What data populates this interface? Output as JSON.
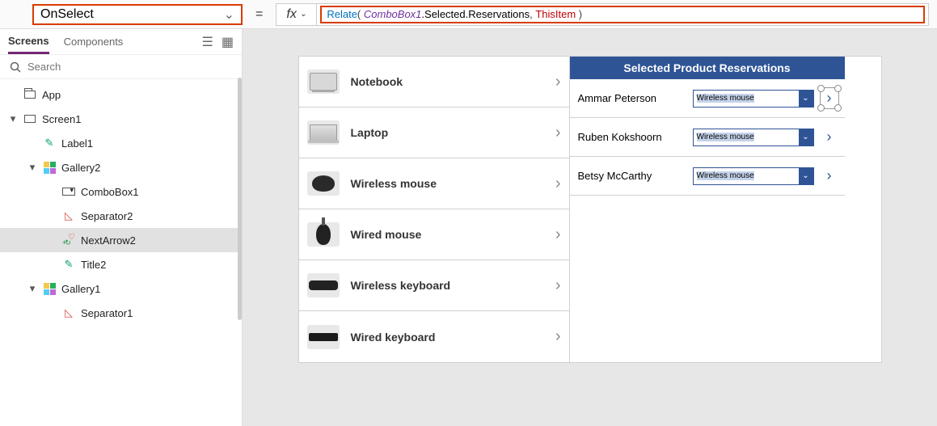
{
  "property_selector": {
    "value": "OnSelect"
  },
  "formula_bar": {
    "fx_label": "fx",
    "tokens": {
      "fn": "Relate",
      "p1": "( ",
      "var": "ComboBox1",
      "prop": ".Selected.Reservations",
      "c": ", ",
      "this": "ThisItem",
      "p2": " )"
    }
  },
  "sidebar": {
    "tabs": {
      "screens": "Screens",
      "components": "Components"
    },
    "search_placeholder": "Search",
    "tree": [
      {
        "type": "app",
        "label": "App",
        "indent": 0,
        "exp": ""
      },
      {
        "type": "screen",
        "label": "Screen1",
        "indent": 0,
        "exp": "▾"
      },
      {
        "type": "label",
        "label": "Label1",
        "indent": 1,
        "exp": ""
      },
      {
        "type": "gallery",
        "label": "Gallery2",
        "indent": 1,
        "exp": "▾"
      },
      {
        "type": "combo",
        "label": "ComboBox1",
        "indent": 2,
        "exp": ""
      },
      {
        "type": "sep",
        "label": "Separator2",
        "indent": 2,
        "exp": ""
      },
      {
        "type": "next",
        "label": "NextArrow2",
        "indent": 2,
        "exp": "",
        "sel": true
      },
      {
        "type": "label",
        "label": "Title2",
        "indent": 2,
        "exp": ""
      },
      {
        "type": "gallery",
        "label": "Gallery1",
        "indent": 1,
        "exp": "▾"
      },
      {
        "type": "sep",
        "label": "Separator1",
        "indent": 2,
        "exp": ""
      }
    ]
  },
  "canvas": {
    "left_gallery": [
      {
        "name": "Notebook",
        "thumb": "note"
      },
      {
        "name": "Laptop",
        "thumb": "lap"
      },
      {
        "name": "Wireless mouse",
        "thumb": "wm"
      },
      {
        "name": "Wired mouse",
        "thumb": "wd"
      },
      {
        "name": "Wireless keyboard",
        "thumb": "wk"
      },
      {
        "name": "Wired keyboard",
        "thumb": "wdk"
      }
    ],
    "right_gallery": {
      "header": "Selected Product Reservations",
      "combo_value": "Wireless mouse",
      "rows": [
        {
          "name": "Ammar Peterson"
        },
        {
          "name": "Ruben Kokshoorn"
        },
        {
          "name": "Betsy McCarthy"
        }
      ]
    }
  }
}
